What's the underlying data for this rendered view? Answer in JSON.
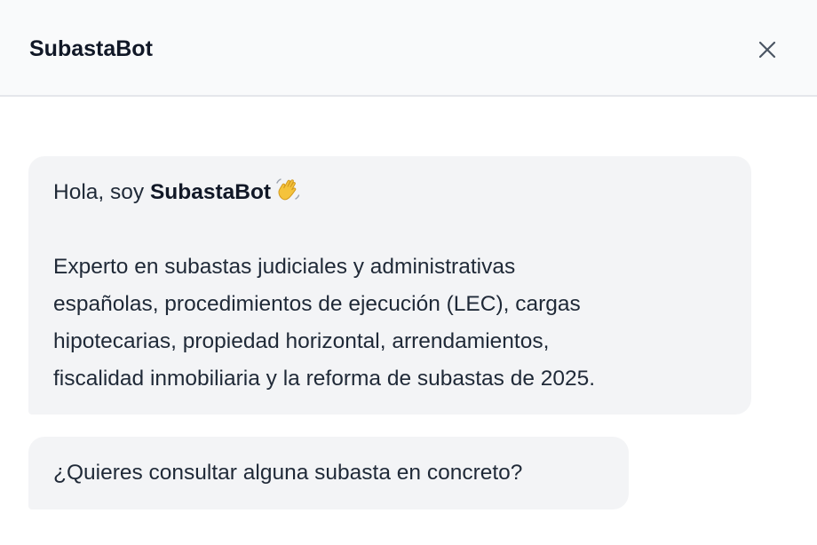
{
  "header": {
    "title": "SubastaBot",
    "close_icon": "close-icon"
  },
  "messages": [
    {
      "greeting_prefix": "Hola, soy ",
      "greeting_name": "SubastaBot",
      "greeting_icon": "waving-hand-icon",
      "body_lines": [
        "Experto en subastas judiciales y administrativas",
        "españolas, procedimientos de ejecución (LEC), cargas",
        "hipotecarias, propiedad horizontal, arrendamientos,",
        "fiscalidad inmobiliaria y la reforma de subastas de 2025."
      ]
    },
    {
      "text": "¿Quieres consultar alguna subasta en concreto?"
    }
  ],
  "colors": {
    "header_bg": "#f9fafb",
    "bubble_bg": "#f3f4f6",
    "text": "#1f2937"
  }
}
